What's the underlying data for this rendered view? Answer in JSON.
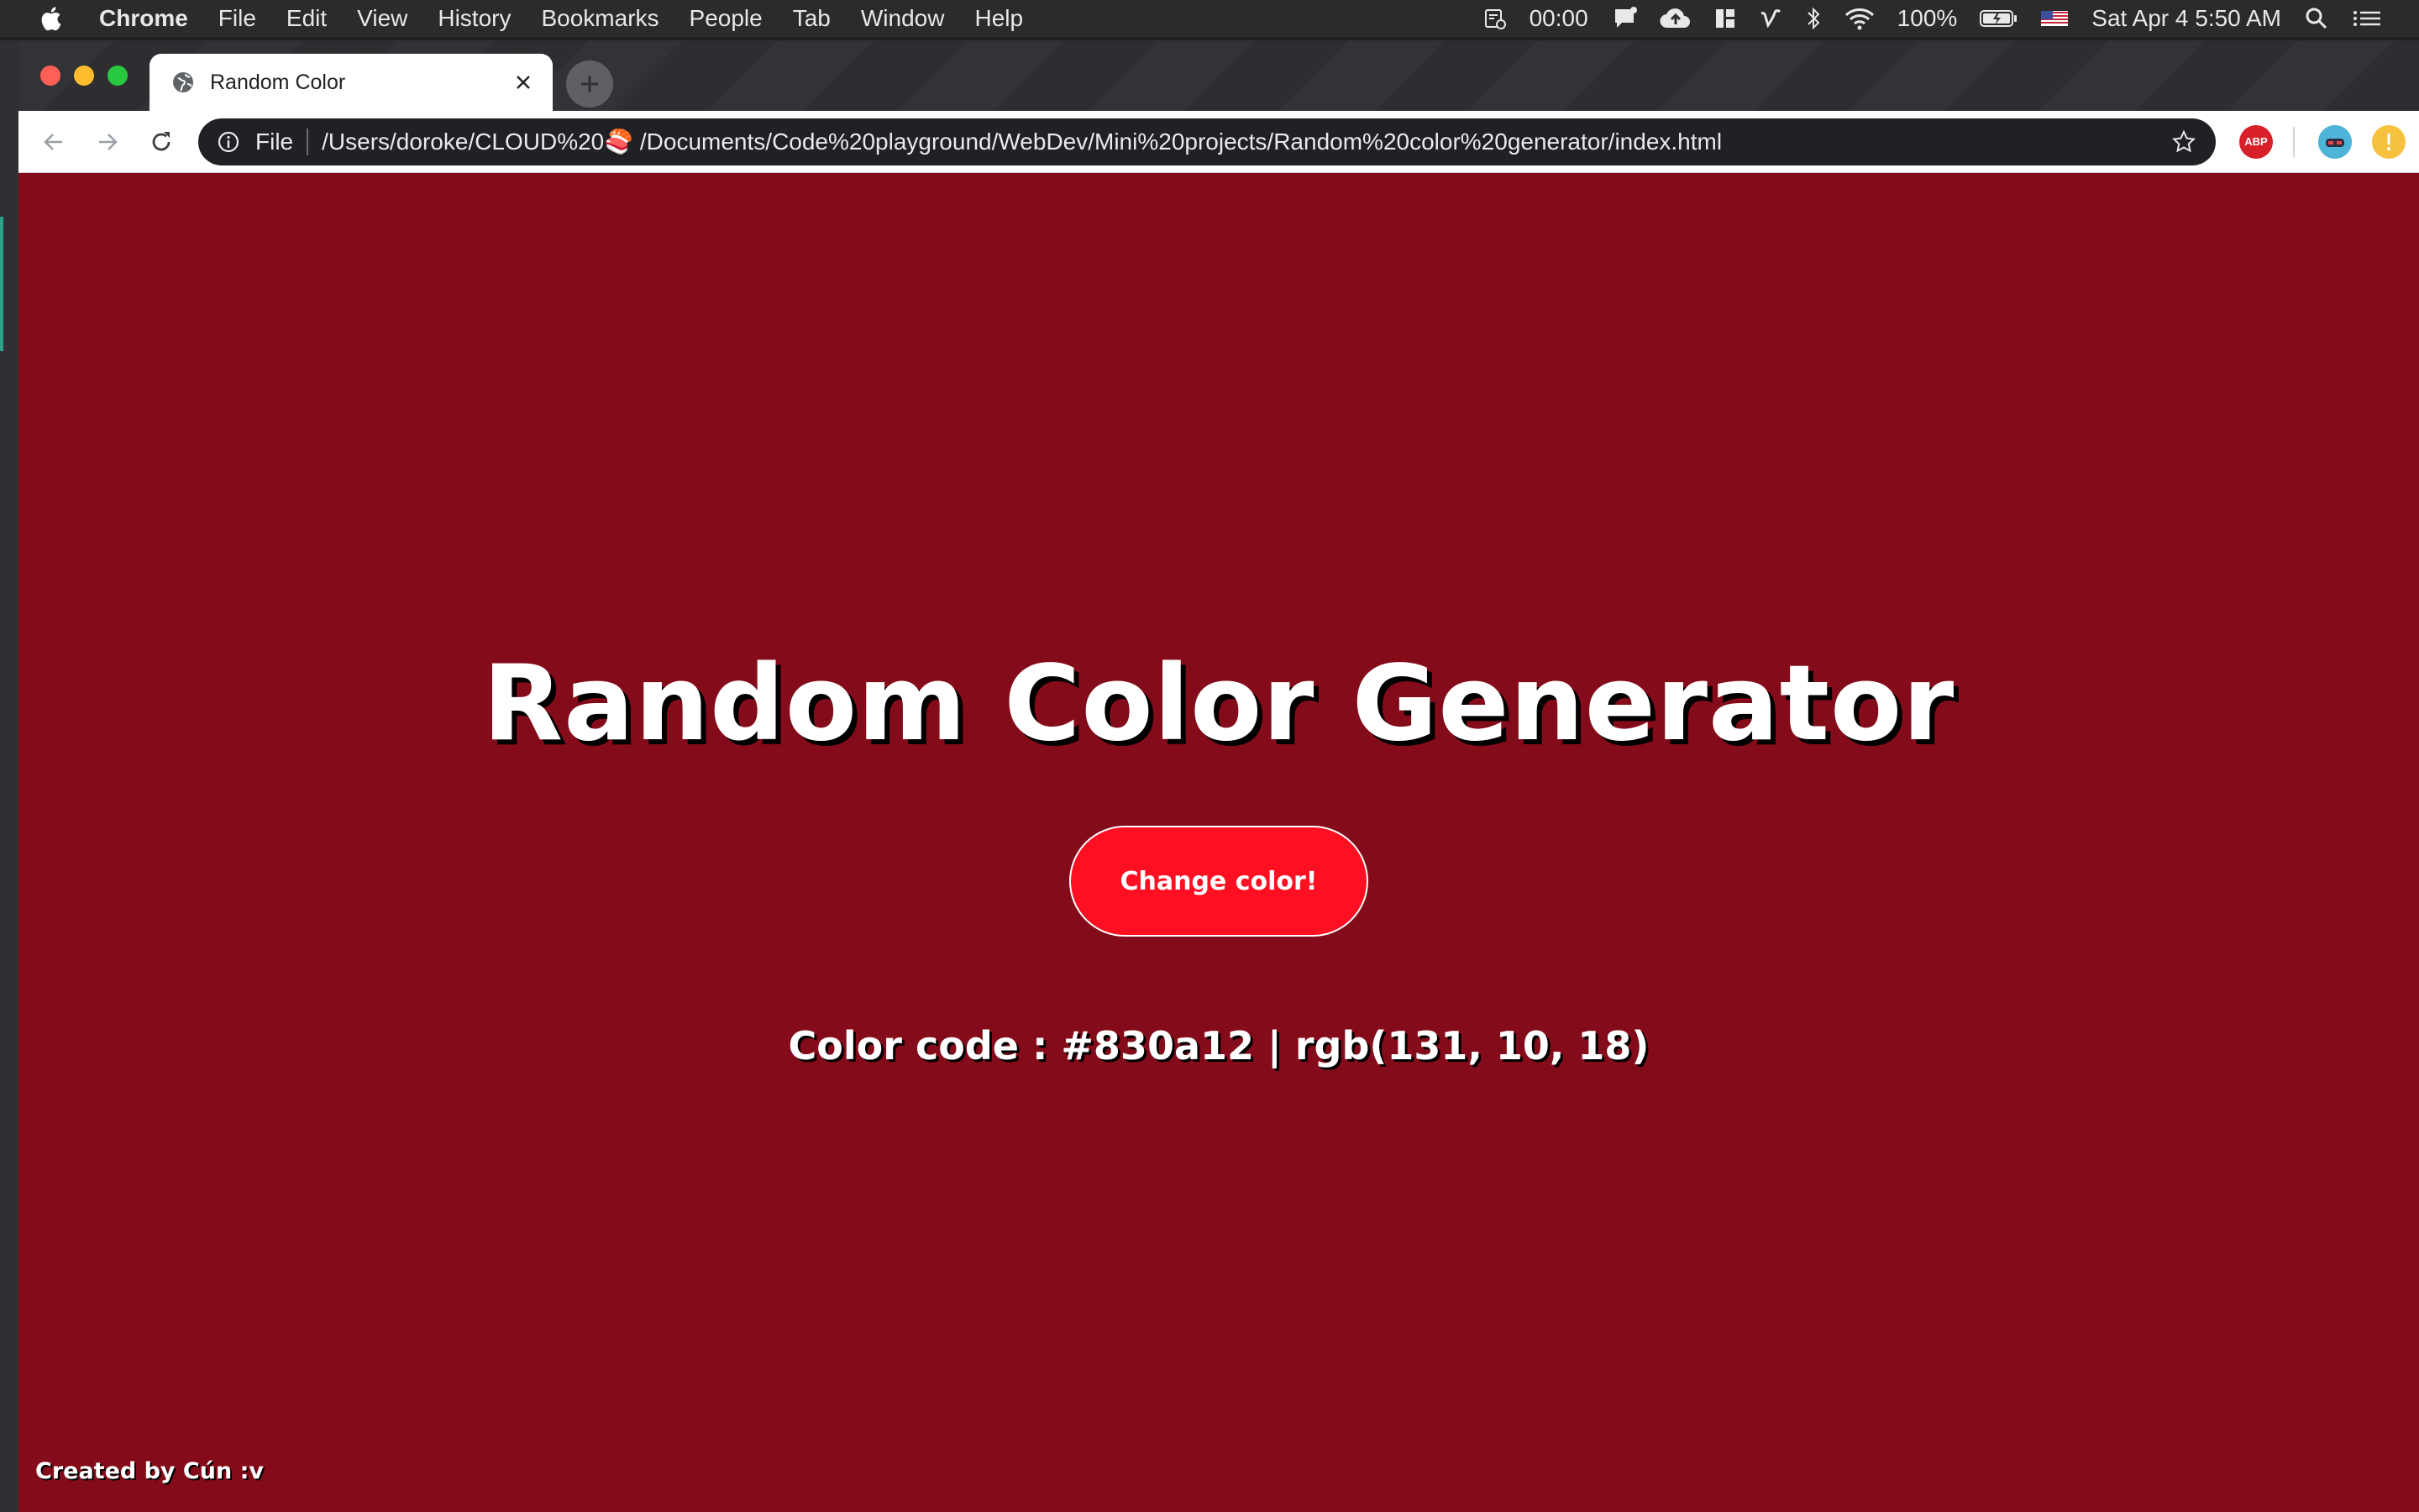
{
  "menubar": {
    "app_name": "Chrome",
    "items": [
      "File",
      "Edit",
      "View",
      "History",
      "Bookmarks",
      "People",
      "Tab",
      "Window",
      "Help"
    ],
    "timer": "00:00",
    "battery": "100%",
    "datetime": "Sat Apr 4  5:50 AM"
  },
  "tab": {
    "title": "Random Color"
  },
  "toolbar": {
    "scheme": "File",
    "url": "/Users/doroke/CLOUD%20🍣 /Documents/Code%20playground/WebDev/Mini%20projects/Random%20color%20generator/index.html",
    "abp_label": "ABP"
  },
  "page": {
    "title": "Random Color Generator",
    "button_label": "Change color!",
    "color_code_text": "Color code : #830a12 | rgb(131, 10, 18)",
    "credit": "Created by Cún :v"
  },
  "colors": {
    "background": "#840b19",
    "button": "#ff0f22",
    "text": "#ffffff"
  }
}
